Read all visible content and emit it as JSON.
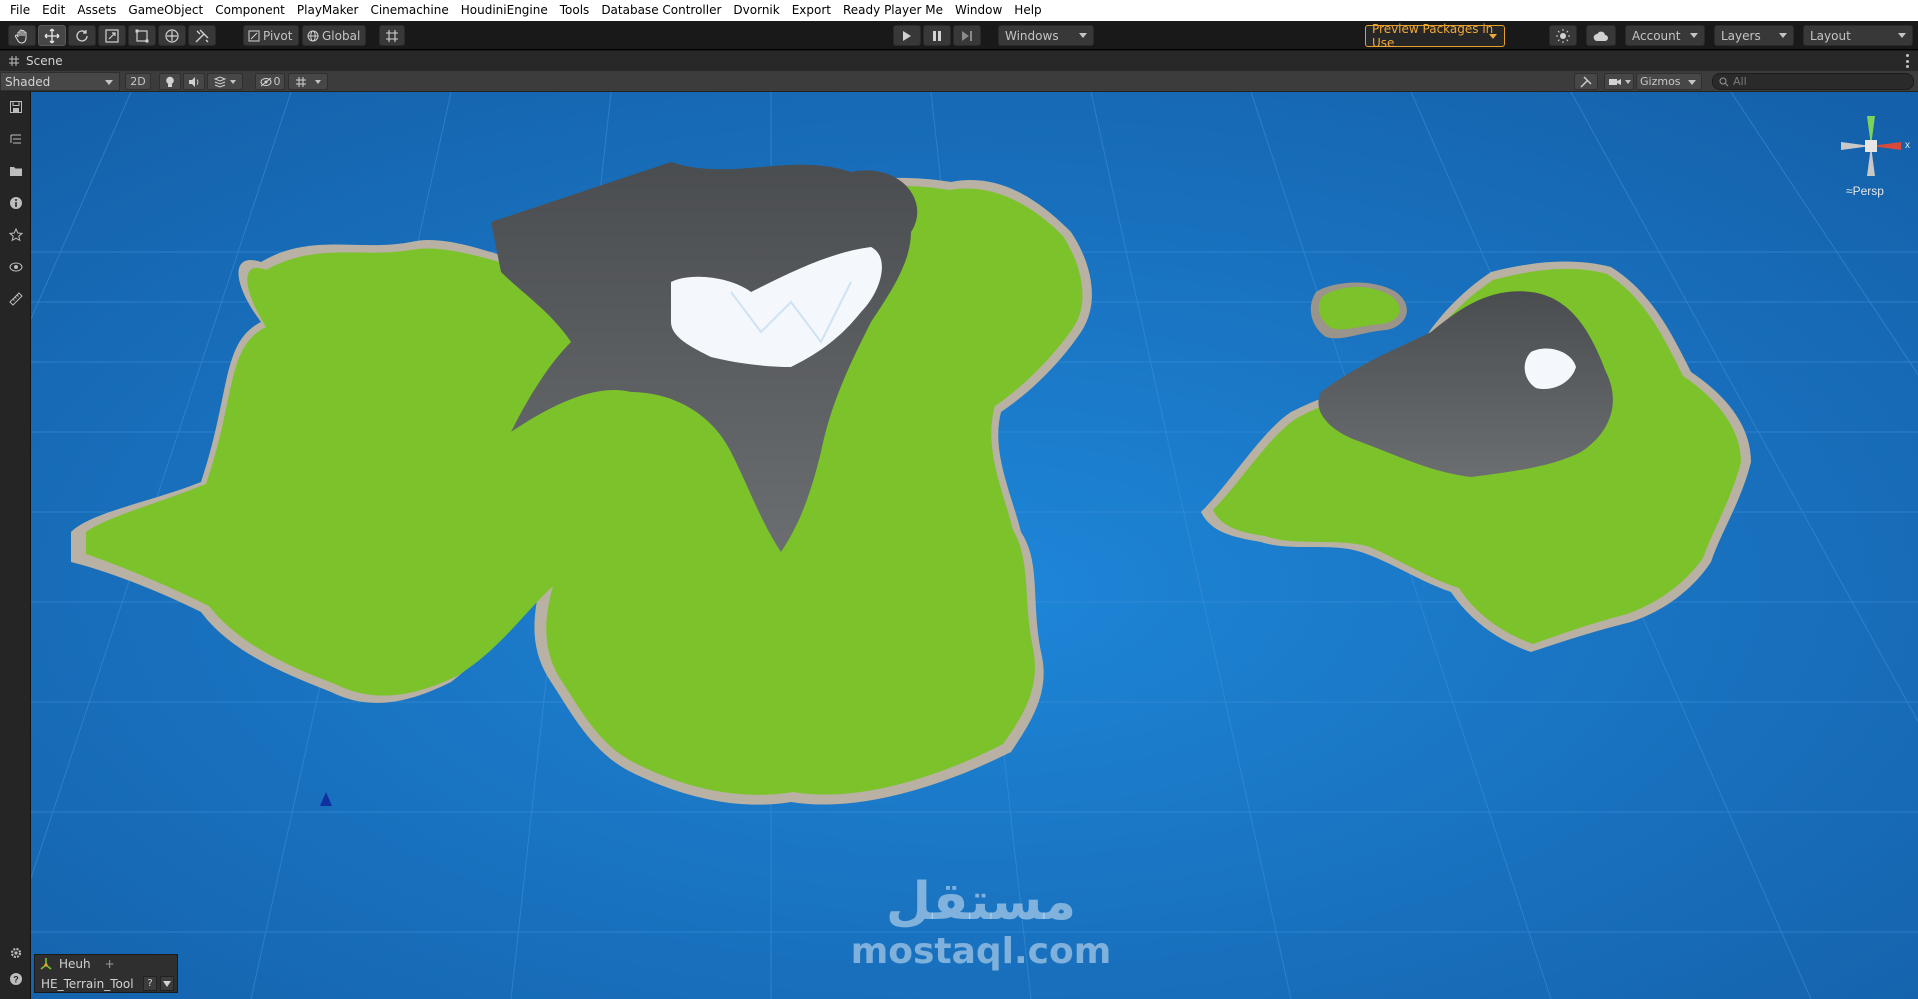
{
  "menu": {
    "items": [
      "File",
      "Edit",
      "Assets",
      "GameObject",
      "Component",
      "PlayMaker",
      "Cinemachine",
      "HoudiniEngine",
      "Tools",
      "Database Controller",
      "Dvornik",
      "Export",
      "Ready Player Me",
      "Window",
      "Help"
    ]
  },
  "toolbar": {
    "tools": [
      "hand-icon",
      "move-icon",
      "rotate-icon",
      "scale-icon",
      "rect-icon",
      "transform-icon",
      "custom-tool-icon"
    ],
    "pivot_label": "Pivot",
    "global_label": "Global",
    "platform_label": "Windows",
    "preview_packages_label": "Preview Packages in Use",
    "account_label": "Account",
    "layers_label": "Layers",
    "layout_label": "Layout"
  },
  "scene_tab": {
    "title": "Scene"
  },
  "scene_toolbar": {
    "draw_mode": "Shaded",
    "toggle_2d": "2D",
    "hidden_count": "0",
    "gizmos_label": "Gizmos",
    "search_placeholder": "All"
  },
  "viewport": {
    "projection_label": "Persp",
    "axis_x": "x",
    "watermark_arabic": "مستقل",
    "watermark_latin": "mostaql.com"
  },
  "overlay": {
    "tool_name": "Heuh",
    "add_label": "+",
    "asset_name": "HE_Terrain_Tool",
    "help_label": "?"
  },
  "colors": {
    "sea": "#1a72c4",
    "grass": "#7cc22b",
    "rock": "#55585a",
    "snow": "#f4f8fc",
    "preview_accent": "#e59d2b"
  }
}
